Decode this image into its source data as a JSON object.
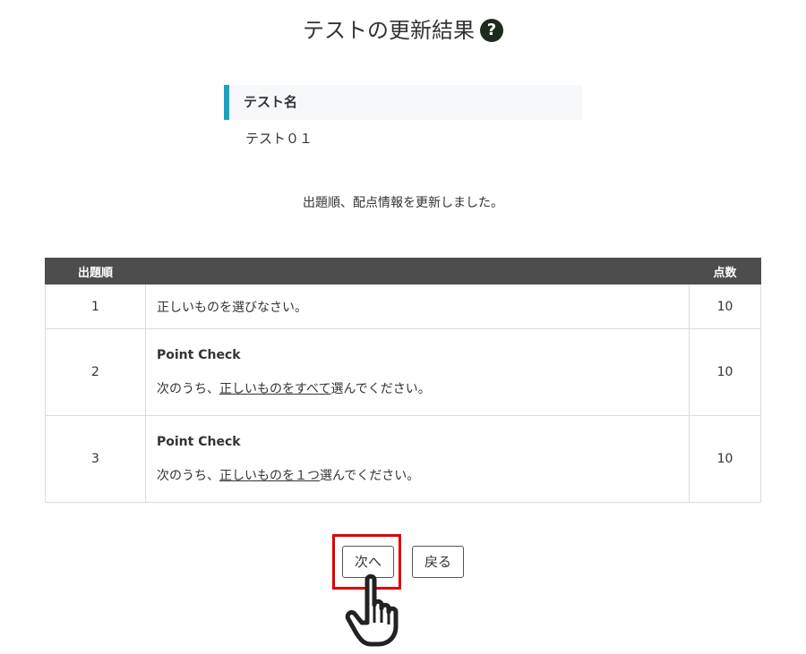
{
  "page": {
    "title": "テストの更新結果",
    "help_icon_glyph": "?"
  },
  "test_info": {
    "label": "テスト名",
    "value": "テスト０１"
  },
  "message": "出題順、配点情報を更新しました。",
  "table": {
    "headers": {
      "order": "出題順",
      "question": "",
      "score": "点数"
    },
    "rows": [
      {
        "order": "1",
        "text": "正しいものを選びなさい。",
        "score": "10"
      },
      {
        "order": "2",
        "heading": "Point Check",
        "text_before": "次のうち、",
        "text_underlined": "正しいものをすべて",
        "text_after": "選んでください。",
        "score": "10"
      },
      {
        "order": "3",
        "heading": "Point Check",
        "text_before": "次のうち、",
        "text_underlined": "正しいものを１つ",
        "text_after": "選んでください。",
        "score": "10"
      }
    ]
  },
  "buttons": {
    "next_label": "次へ",
    "back_label": "戻る"
  },
  "colors": {
    "accent_bar": "#1aa3c2",
    "table_header_bg": "#4d4d4d",
    "highlight_border": "#e00000"
  },
  "icons": {
    "help": "question-circle-icon",
    "cursor": "pointing-hand-cursor-icon"
  }
}
